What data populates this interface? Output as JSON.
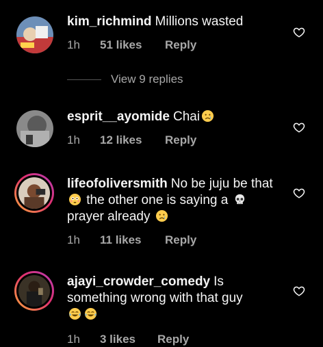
{
  "comments": [
    {
      "username": "kim_richmind",
      "text": "Millions wasted",
      "time": "1h",
      "likes": "51 likes",
      "reply": "Reply"
    },
    {
      "username": "esprit__ayomide",
      "text": "Chai",
      "time": "1h",
      "likes": "12 likes",
      "reply": "Reply"
    },
    {
      "username": "lifeofoliversmith",
      "text_part1": "No be juju be that",
      "text_part2": "the other one is saying a",
      "text_part3": "prayer already",
      "time": "1h",
      "likes": "11 likes",
      "reply": "Reply"
    },
    {
      "username": "ajayi_crowder_comedy",
      "text": "Is something wrong with that guy",
      "time": "1h",
      "likes": "3 likes",
      "reply": "Reply"
    }
  ],
  "view_replies": "View 9 replies",
  "colors": {
    "background": "#000000",
    "text": "#f5f5f5",
    "secondary": "#a8a8a8",
    "story_ring_start": "#f9a93b",
    "story_ring_end": "#b53db8"
  },
  "icons": {
    "like": "heart-outline-icon",
    "crying": "crying-face-emoji",
    "flushed": "flushed-face-emoji",
    "skull": "skull-emoji",
    "laughing": "tears-of-joy-emoji"
  }
}
